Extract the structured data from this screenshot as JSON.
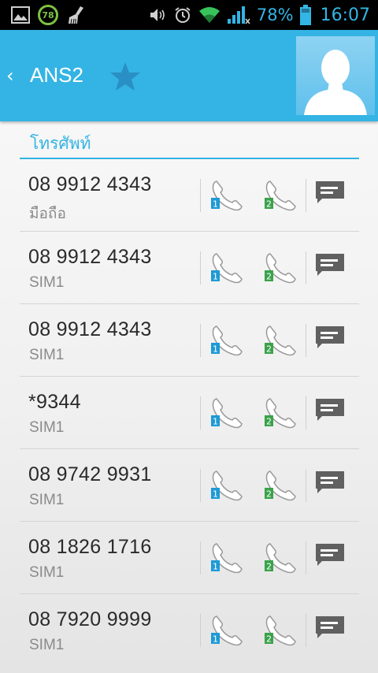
{
  "status_bar": {
    "badge_value": "78",
    "battery_percent": "78%",
    "time": "16:07",
    "icons": [
      "image-icon",
      "cleaner-icon",
      "vibrate-icon",
      "alarm-icon",
      "wifi-icon",
      "signal-icon",
      "battery-icon"
    ]
  },
  "header": {
    "back_icon": "‹",
    "name": "ANS2",
    "star_color": "#2a8fc4",
    "accent_color": "#34b4e4"
  },
  "section": {
    "title": "โทรศัพท์"
  },
  "sim_badges": {
    "sim1": "1",
    "sim2": "2",
    "sim1_color": "#1e9ad6",
    "sim2_color": "#3aa24a"
  },
  "numbers": [
    {
      "number": "08 9912 4343",
      "label": "มือถือ"
    },
    {
      "number": "08 9912 4343",
      "label": "SIM1"
    },
    {
      "number": "08 9912 4343",
      "label": "SIM1"
    },
    {
      "number": "*9344",
      "label": "SIM1"
    },
    {
      "number": "08 9742 9931",
      "label": "SIM1"
    },
    {
      "number": "08 1826 1716",
      "label": "SIM1"
    },
    {
      "number": "08 7920 9999",
      "label": "SIM1"
    }
  ]
}
